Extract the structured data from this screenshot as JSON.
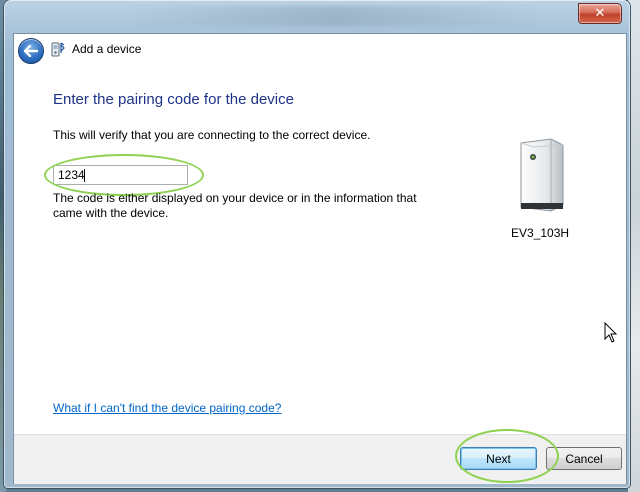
{
  "window": {
    "close_glyph": "✕"
  },
  "nav": {
    "back_icon": "back-arrow-icon",
    "wizard_icon": "bluetooth-device-icon",
    "title": "Add a device"
  },
  "page": {
    "heading": "Enter the pairing code for the device",
    "description": "This will verify that you are connecting to the correct device.",
    "code_value": "1234",
    "hint": "The code is either displayed on your device or in the information that came with the device.",
    "help_link": "What if I can't find the device pairing code?"
  },
  "device": {
    "name": "EV3_103H",
    "icon": "computer-tower-icon"
  },
  "footer": {
    "next_label": "Next",
    "cancel_label": "Cancel"
  },
  "colors": {
    "heading": "#1e3287",
    "link": "#0066cc",
    "annotation": "#8fd150"
  }
}
